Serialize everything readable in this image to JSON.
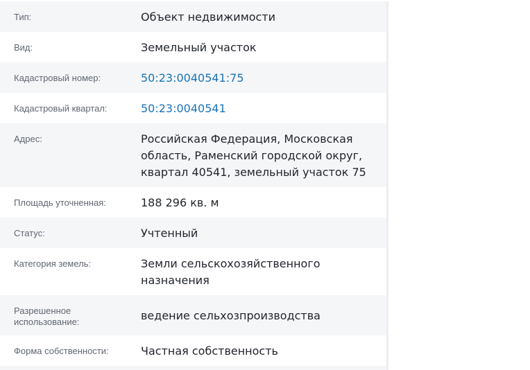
{
  "property_details": {
    "rows": [
      {
        "label": "Тип:",
        "value": "Объект недвижимости"
      },
      {
        "label": "Вид:",
        "value": "Земельный участок"
      },
      {
        "label": "Кадастровый номер:",
        "value": "50:23:0040541:75"
      },
      {
        "label": "Кадастровый квартал:",
        "value": "50:23:0040541"
      },
      {
        "label": "Адрес:",
        "value": "Российская Федерация, Московская область, Раменский городской округ, квартал 40541, земельный участок 75"
      },
      {
        "label": "Площадь уточненная:",
        "value": "188 296 кв. м"
      },
      {
        "label": "Статус:",
        "value": "Учтенный"
      },
      {
        "label": "Категория земель:",
        "value": "Земли сельскохозяйственного назначения"
      },
      {
        "label": "Разрешенное использование:",
        "value": "ведение сельхозпроизводства"
      },
      {
        "label": "Форма собственности:",
        "value": "Частная собственность"
      }
    ]
  }
}
